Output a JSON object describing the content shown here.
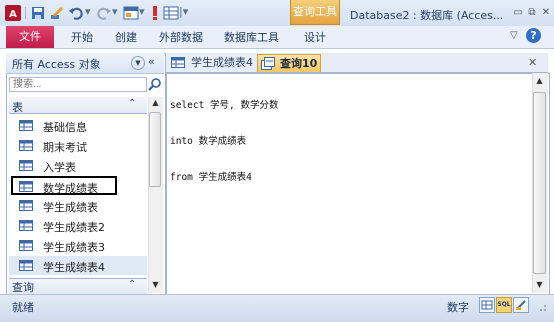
{
  "titlebar": {
    "context_tab": "查询工具",
    "window_title": "Database2 : 数据库 (Acces...",
    "quick_access_glyphs": [
      "▾",
      "▾",
      "▾",
      "|▾"
    ]
  },
  "ribbon": {
    "file_tab": "文件",
    "tabs": [
      "开始",
      "创建",
      "外部数据",
      "数据库工具",
      "设计"
    ]
  },
  "nav": {
    "title": "所有 Access 对象",
    "search_placeholder": "搜索...",
    "group_label": "表",
    "items": [
      "基础信息",
      "期末考试",
      "入学表",
      "数学成绩表",
      "学生成绩表",
      "学生成绩表2",
      "学生成绩表3",
      "学生成绩表4"
    ],
    "selected_index": 3,
    "group2_label": "查询"
  },
  "doc": {
    "tabs": [
      "学生成绩表4",
      "查询10"
    ],
    "active_tab": 1,
    "sql_lines": [
      "select 学号, 数学分数",
      "into 数学成绩表",
      "from 学生成绩表4"
    ]
  },
  "status": {
    "text": "就绪",
    "lang": "数字",
    "view_sql": "SQL"
  },
  "colors": {
    "file_tab": "#c8254f",
    "context_tab": "#e8a94a",
    "active_doc_tab": "#f7d27a"
  }
}
